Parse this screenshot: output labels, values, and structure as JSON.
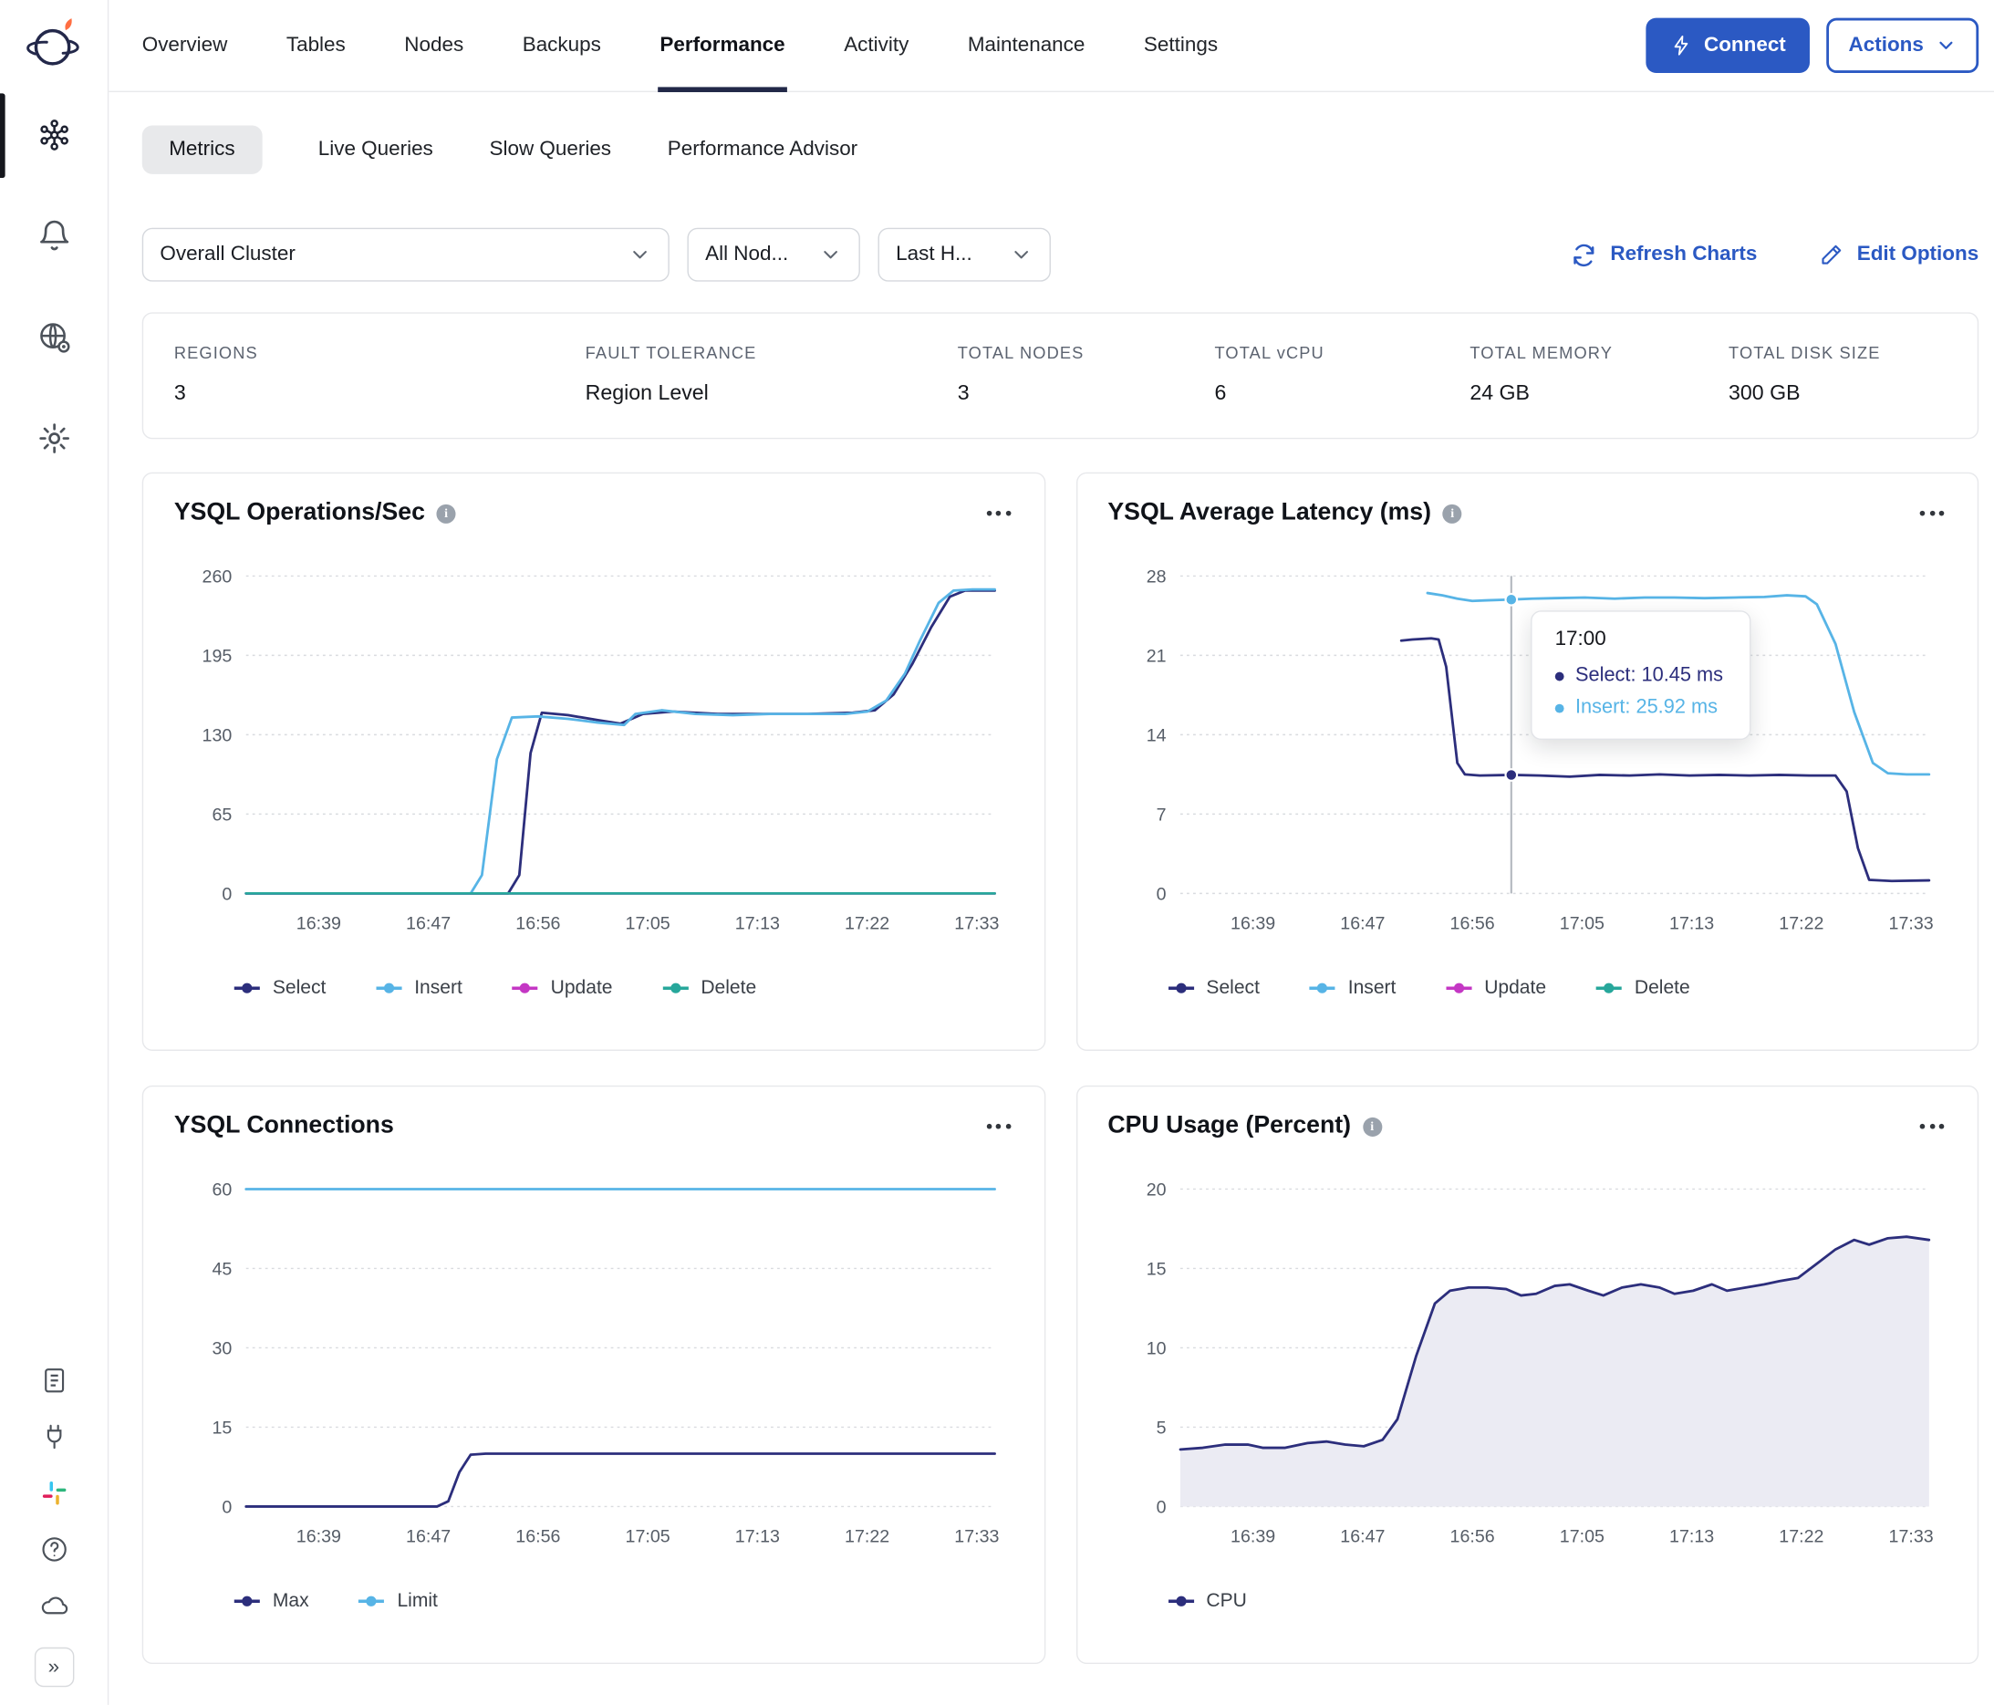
{
  "app": {
    "accent_color": "#2b59c3"
  },
  "icons": {
    "sidebar": [
      "logo",
      "clusters-network",
      "bell",
      "globe-gear",
      "gear",
      "docs",
      "plug",
      "slack",
      "help",
      "cloud",
      "collapse-chevrons"
    ],
    "connect_button": "lightning-bolt",
    "actions_button": "chevron-down",
    "refresh": "refresh-arrows",
    "edit": "pencil",
    "chart_menu": "ellipsis",
    "chart_info": "info-circle"
  },
  "header": {
    "tabs": [
      "Overview",
      "Tables",
      "Nodes",
      "Backups",
      "Performance",
      "Activity",
      "Maintenance",
      "Settings"
    ],
    "active_tab": "Performance",
    "connect_label": "Connect",
    "actions_label": "Actions"
  },
  "subtabs": {
    "items": [
      "Metrics",
      "Live Queries",
      "Slow Queries",
      "Performance Advisor"
    ],
    "active": "Metrics"
  },
  "filters": {
    "cluster_select": "Overall Cluster",
    "nodes_select": "All Nod...",
    "time_select": "Last H...",
    "refresh_label": "Refresh Charts",
    "edit_label": "Edit Options"
  },
  "summary": {
    "items": [
      {
        "label": "REGIONS",
        "value": "3"
      },
      {
        "label": "FAULT TOLERANCE",
        "value": "Region Level"
      },
      {
        "label": "TOTAL NODES",
        "value": "3"
      },
      {
        "label": "TOTAL vCPU",
        "value": "6"
      },
      {
        "label": "TOTAL MEMORY",
        "value": "24 GB"
      },
      {
        "label": "TOTAL DISK SIZE",
        "value": "300 GB"
      }
    ]
  },
  "chart_data": [
    {
      "id": "ysql-operations-per-sec",
      "type": "line",
      "title": "YSQL Operations/Sec",
      "x_ticks": [
        "16:39",
        "16:47",
        "16:56",
        "17:05",
        "17:13",
        "17:22",
        "17:33"
      ],
      "y_ticks": [
        0,
        65,
        130,
        195,
        260
      ],
      "ylim": [
        0,
        260
      ],
      "grid": "dotted-horizontal",
      "legend_position": "bottom",
      "series": [
        {
          "name": "Select",
          "color": "#2c2e7c",
          "points": [
            [
              0,
              0
            ],
            [
              0.35,
              0
            ],
            [
              0.365,
              15
            ],
            [
              0.38,
              115
            ],
            [
              0.395,
              148
            ],
            [
              0.43,
              146
            ],
            [
              0.47,
              142
            ],
            [
              0.5,
              139
            ],
            [
              0.53,
              147
            ],
            [
              0.57,
              149
            ],
            [
              0.63,
              147
            ],
            [
              0.69,
              147
            ],
            [
              0.75,
              147
            ],
            [
              0.81,
              148
            ],
            [
              0.84,
              150
            ],
            [
              0.865,
              163
            ],
            [
              0.89,
              188
            ],
            [
              0.915,
              218
            ],
            [
              0.94,
              243
            ],
            [
              0.96,
              248
            ],
            [
              1,
              248
            ]
          ]
        },
        {
          "name": "Insert",
          "color": "#57b4e6",
          "points": [
            [
              0,
              0
            ],
            [
              0.3,
              0
            ],
            [
              0.315,
              15
            ],
            [
              0.335,
              110
            ],
            [
              0.355,
              144
            ],
            [
              0.39,
              145
            ],
            [
              0.43,
              143
            ],
            [
              0.47,
              140
            ],
            [
              0.505,
              138
            ],
            [
              0.52,
              147
            ],
            [
              0.555,
              150
            ],
            [
              0.6,
              147
            ],
            [
              0.65,
              146
            ],
            [
              0.7,
              147
            ],
            [
              0.75,
              147
            ],
            [
              0.8,
              147
            ],
            [
              0.83,
              149
            ],
            [
              0.855,
              158
            ],
            [
              0.88,
              180
            ],
            [
              0.9,
              207
            ],
            [
              0.925,
              238
            ],
            [
              0.945,
              248
            ],
            [
              0.97,
              249
            ],
            [
              1,
              249
            ]
          ]
        },
        {
          "name": "Update",
          "color": "#c437c4",
          "points": [
            [
              0,
              0
            ],
            [
              1,
              0
            ]
          ]
        },
        {
          "name": "Delete",
          "color": "#27a79b",
          "points": [
            [
              0,
              0
            ],
            [
              1,
              0
            ]
          ]
        }
      ]
    },
    {
      "id": "ysql-average-latency-ms",
      "type": "line",
      "title": "YSQL Average Latency (ms)",
      "x_ticks": [
        "16:39",
        "16:47",
        "16:56",
        "17:05",
        "17:13",
        "17:22",
        "17:33"
      ],
      "y_ticks": [
        0,
        7,
        14,
        21,
        28
      ],
      "ylim": [
        0,
        28
      ],
      "grid": "dotted-horizontal",
      "legend_position": "bottom",
      "series": [
        {
          "name": "Select",
          "color": "#2c2e7c",
          "points": [
            [
              0.295,
              22.3
            ],
            [
              0.31,
              22.4
            ],
            [
              0.335,
              22.5
            ],
            [
              0.345,
              22.4
            ],
            [
              0.355,
              20
            ],
            [
              0.37,
              11.5
            ],
            [
              0.38,
              10.5
            ],
            [
              0.4,
              10.4
            ],
            [
              0.442,
              10.45
            ],
            [
              0.48,
              10.4
            ],
            [
              0.52,
              10.3
            ],
            [
              0.56,
              10.45
            ],
            [
              0.6,
              10.4
            ],
            [
              0.64,
              10.5
            ],
            [
              0.68,
              10.4
            ],
            [
              0.72,
              10.45
            ],
            [
              0.76,
              10.4
            ],
            [
              0.8,
              10.45
            ],
            [
              0.84,
              10.4
            ],
            [
              0.875,
              10.4
            ],
            [
              0.89,
              9
            ],
            [
              0.905,
              4
            ],
            [
              0.92,
              1.2
            ],
            [
              0.95,
              1.1
            ],
            [
              1,
              1.15
            ]
          ]
        },
        {
          "name": "Insert",
          "color": "#57b4e6",
          "points": [
            [
              0.33,
              26.5
            ],
            [
              0.35,
              26.3
            ],
            [
              0.37,
              26
            ],
            [
              0.39,
              25.8
            ],
            [
              0.41,
              25.85
            ],
            [
              0.442,
              25.92
            ],
            [
              0.47,
              26
            ],
            [
              0.5,
              26.05
            ],
            [
              0.54,
              26.1
            ],
            [
              0.58,
              26
            ],
            [
              0.62,
              26.1
            ],
            [
              0.66,
              26.1
            ],
            [
              0.7,
              26.05
            ],
            [
              0.74,
              26.1
            ],
            [
              0.78,
              26.15
            ],
            [
              0.81,
              26.3
            ],
            [
              0.835,
              26.2
            ],
            [
              0.85,
              25.5
            ],
            [
              0.875,
              22
            ],
            [
              0.9,
              16
            ],
            [
              0.925,
              11.5
            ],
            [
              0.945,
              10.6
            ],
            [
              0.97,
              10.5
            ],
            [
              1,
              10.5
            ]
          ]
        },
        {
          "name": "Update",
          "color": "#c437c4",
          "points": []
        },
        {
          "name": "Delete",
          "color": "#27a79b",
          "points": []
        }
      ],
      "crosshair": {
        "x_frac": 0.442,
        "markers": [
          {
            "value": 25.92,
            "color": "#57b4e6"
          },
          {
            "value": 10.45,
            "color": "#2c2e7c"
          }
        ]
      },
      "tooltip": {
        "time": "17:00",
        "rows": [
          {
            "series": "Select",
            "label": "Select: 10.45 ms",
            "color": "#2c2e7c"
          },
          {
            "series": "Insert",
            "label": "Insert: 25.92 ms",
            "color": "#57b4e6"
          }
        ]
      }
    },
    {
      "id": "ysql-connections",
      "type": "line",
      "title": "YSQL Connections",
      "x_ticks": [
        "16:39",
        "16:47",
        "16:56",
        "17:05",
        "17:13",
        "17:22",
        "17:33"
      ],
      "y_ticks": [
        0,
        15,
        30,
        45,
        60
      ],
      "ylim": [
        0,
        60
      ],
      "grid": "dotted-horizontal",
      "legend_position": "bottom",
      "series": [
        {
          "name": "Max",
          "color": "#2c2e7c",
          "points": [
            [
              0,
              0
            ],
            [
              0.255,
              0
            ],
            [
              0.27,
              1
            ],
            [
              0.285,
              6.5
            ],
            [
              0.3,
              9.8
            ],
            [
              0.32,
              10
            ],
            [
              1,
              10
            ]
          ]
        },
        {
          "name": "Limit",
          "color": "#57b4e6",
          "points": [
            [
              0,
              60
            ],
            [
              1,
              60
            ]
          ]
        }
      ]
    },
    {
      "id": "cpu-usage-percent",
      "type": "area",
      "title": "CPU Usage (Percent)",
      "x_ticks": [
        "16:39",
        "16:47",
        "16:56",
        "17:05",
        "17:13",
        "17:22",
        "17:33"
      ],
      "y_ticks": [
        0,
        5,
        10,
        15,
        20
      ],
      "ylim": [
        0,
        20
      ],
      "grid": "dotted-horizontal",
      "legend_position": "bottom",
      "series": [
        {
          "name": "CPU",
          "color": "#2c2e7c",
          "fill": "#ebebf3",
          "points": [
            [
              0,
              3.6
            ],
            [
              0.03,
              3.7
            ],
            [
              0.06,
              3.9
            ],
            [
              0.09,
              3.9
            ],
            [
              0.11,
              3.7
            ],
            [
              0.14,
              3.7
            ],
            [
              0.17,
              4
            ],
            [
              0.195,
              4.1
            ],
            [
              0.22,
              3.9
            ],
            [
              0.245,
              3.8
            ],
            [
              0.27,
              4.2
            ],
            [
              0.29,
              5.5
            ],
            [
              0.315,
              9.5
            ],
            [
              0.34,
              12.8
            ],
            [
              0.36,
              13.6
            ],
            [
              0.385,
              13.8
            ],
            [
              0.41,
              13.8
            ],
            [
              0.435,
              13.7
            ],
            [
              0.455,
              13.3
            ],
            [
              0.475,
              13.4
            ],
            [
              0.5,
              13.9
            ],
            [
              0.52,
              14
            ],
            [
              0.545,
              13.6
            ],
            [
              0.565,
              13.3
            ],
            [
              0.59,
              13.8
            ],
            [
              0.615,
              14
            ],
            [
              0.64,
              13.8
            ],
            [
              0.66,
              13.4
            ],
            [
              0.685,
              13.6
            ],
            [
              0.71,
              14
            ],
            [
              0.73,
              13.6
            ],
            [
              0.755,
              13.8
            ],
            [
              0.78,
              14
            ],
            [
              0.8,
              14.2
            ],
            [
              0.825,
              14.4
            ],
            [
              0.85,
              15.3
            ],
            [
              0.875,
              16.2
            ],
            [
              0.9,
              16.8
            ],
            [
              0.92,
              16.5
            ],
            [
              0.945,
              16.9
            ],
            [
              0.97,
              17
            ],
            [
              1,
              16.8
            ]
          ]
        }
      ]
    }
  ]
}
